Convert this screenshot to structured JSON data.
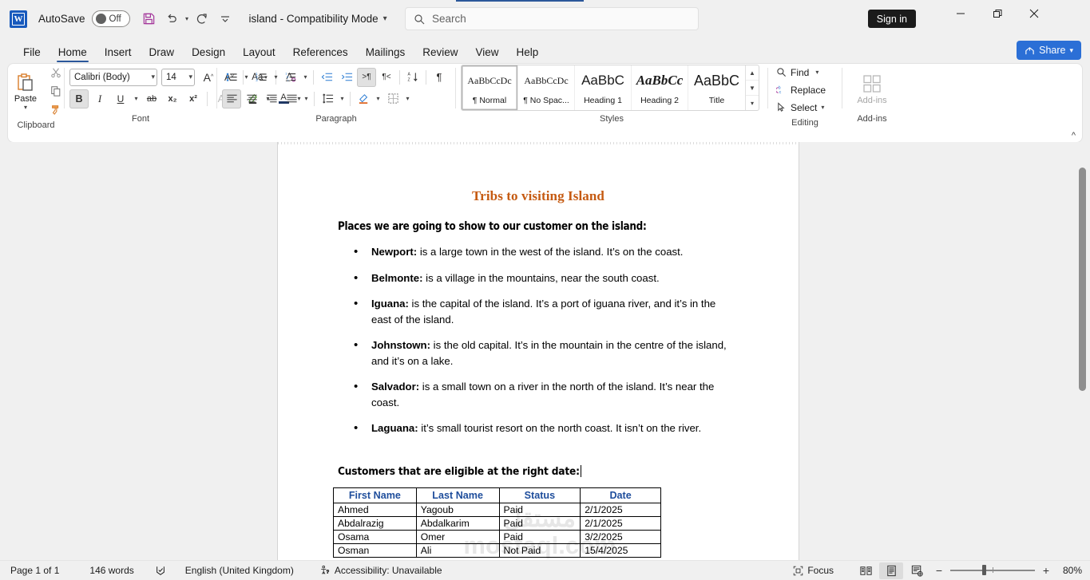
{
  "titlebar": {
    "logo_text": "W",
    "autosave_label": "AutoSave",
    "autosave_state": "Off",
    "save_icon": "save-icon",
    "undo_icon": "undo-icon",
    "redo_icon": "redo-icon",
    "customize_icon": "customize-quick-access-toolbar-icon",
    "document_name": "island  -  Compatibility Mode",
    "signin_label": "Sign in",
    "minimize_label": "—",
    "restore_label": "❐",
    "close_label": "✕"
  },
  "search": {
    "placeholder": "Search",
    "value": "",
    "icon": "search-icon"
  },
  "tabs": [
    {
      "label": "File",
      "active": false
    },
    {
      "label": "Home",
      "active": true
    },
    {
      "label": "Insert",
      "active": false
    },
    {
      "label": "Draw",
      "active": false
    },
    {
      "label": "Design",
      "active": false
    },
    {
      "label": "Layout",
      "active": false
    },
    {
      "label": "References",
      "active": false
    },
    {
      "label": "Mailings",
      "active": false
    },
    {
      "label": "Review",
      "active": false
    },
    {
      "label": "View",
      "active": false
    },
    {
      "label": "Help",
      "active": false
    }
  ],
  "share": {
    "label": "Share",
    "icon": "share-icon",
    "color": "#2b6fd6"
  },
  "ribbon": {
    "clipboard": {
      "group_label": "Clipboard",
      "paste_label": "Paste",
      "cut_label": "Cut",
      "copy_label": "Copy",
      "format_painter_label": "Format Painter"
    },
    "font": {
      "group_label": "Font",
      "font_name": "Calibri (Body)",
      "font_size": "14",
      "grow_label": "Increase Font Size",
      "shrink_label": "Decrease Font Size",
      "change_case_label": "Aa",
      "clear_format_label": "Clear All Formatting",
      "bold_label": "B",
      "italic_label": "I",
      "underline_label": "U",
      "strike_label": "ab",
      "subscript_label": "x₂",
      "superscript_label": "x²",
      "text_effects_label": "A",
      "highlight_label": "Text Highlight Color",
      "font_color_label": "A"
    },
    "paragraph": {
      "group_label": "Paragraph",
      "bullets_label": "Bullets",
      "numbering_label": "Numbering",
      "multilevel_label": "Multilevel List",
      "decrease_indent_label": "Decrease Indent",
      "increase_indent_label": "Increase Indent",
      "ltr_label": "Left-to-Right Text Direction",
      "rtl_label": "Right-to-Left Text Direction",
      "sort_label": "Sort",
      "show_marks_label": "¶",
      "align_left_label": "Align Left",
      "align_center_label": "Center",
      "align_right_label": "Align Right",
      "justify_label": "Justify",
      "line_spacing_label": "Line and Paragraph Spacing",
      "shading_label": "Shading",
      "borders_label": "Borders"
    },
    "styles": {
      "group_label": "Styles",
      "items": [
        {
          "preview": "AaBbCcDc",
          "name": "¶ Normal",
          "selected": true
        },
        {
          "preview": "AaBbCcDc",
          "name": "¶ No Spac...",
          "selected": false
        },
        {
          "preview": "AaBbC",
          "name": "Heading 1",
          "selected": false
        },
        {
          "preview": "AaBbCc",
          "name": "Heading 2",
          "selected": false
        },
        {
          "preview": "AaBbC",
          "name": "Title",
          "selected": false
        }
      ]
    },
    "editing": {
      "group_label": "Editing",
      "find_label": "Find",
      "replace_label": "Replace",
      "select_label": "Select"
    },
    "addins": {
      "group_label": "Add-ins",
      "button_label": "Add-ins"
    },
    "collapse_label": "⌃"
  },
  "document": {
    "title": "Tribs to visiting Island",
    "title_color": "#c55a11",
    "subheading": "Places we are going to show to our customer on the island:",
    "bullets": [
      {
        "name": "Newport:",
        "text": " is a large town in the west of the island. It’s on the coast."
      },
      {
        "name": "Belmonte:",
        "text": " is a village in the mountains, near the south coast."
      },
      {
        "name": "Iguana:",
        "text": " is the capital of the island. It’s a port of iguana river, and it’s in the east of the island."
      },
      {
        "name": "Johnstown:",
        "text": " is the old capital. It’s in the mountain in the centre of the island, and it’s on a lake."
      },
      {
        "name": "Salvador:",
        "text": " is a small town on a river in the north of the island. It’s near the coast."
      },
      {
        "name": "Laguana:",
        "text": " it’s small tourist resort on the north coast. It isn’t on the river."
      }
    ],
    "customers_heading": "Customers that are eligible at the right date:",
    "table": {
      "headers": [
        "First Name",
        "Last Name",
        "Status",
        "Date"
      ],
      "header_color": "#1f4e9c",
      "rows": [
        [
          "Ahmed",
          "Yagoub",
          "Paid",
          "2/1/2025"
        ],
        [
          "Abdalrazig",
          "Abdalkarim",
          "Paid",
          "2/1/2025"
        ],
        [
          "Osama",
          "Omer",
          "Paid",
          "3/2/2025"
        ],
        [
          "Osman",
          "Ali",
          "Not Paid",
          "15/4/2025"
        ]
      ]
    },
    "watermark_arabic": "مستقل",
    "watermark": "mostaql.com"
  },
  "statusbar": {
    "page": "Page 1 of 1",
    "words": "146 words",
    "proofing_icon": "proofing-errors-icon",
    "language": "English (United Kingdom)",
    "accessibility_icon": "accessibility-icon",
    "accessibility": "Accessibility: Unavailable",
    "focus_label": "Focus",
    "focus_icon": "focus-icon",
    "read_mode_icon": "read-mode-icon",
    "print_layout_icon": "print-layout-icon",
    "web_layout_icon": "web-layout-icon",
    "zoom_out_label": "−",
    "zoom_in_label": "+",
    "zoom_value": "80%"
  }
}
